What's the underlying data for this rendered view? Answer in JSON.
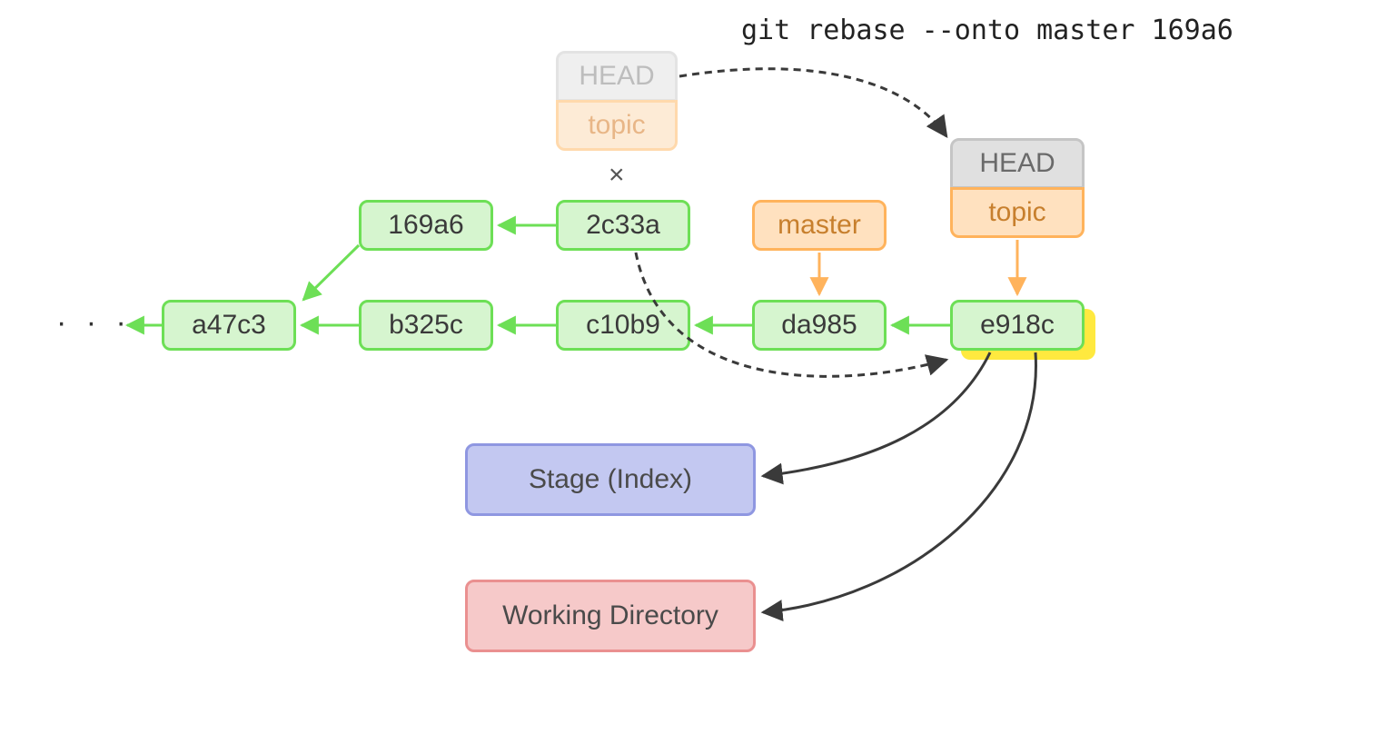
{
  "command": "git rebase --onto master 169a6",
  "ellipsis": "· · ·",
  "cross": "×",
  "commits": {
    "c169a6": "169a6",
    "c2c33a": "2c33a",
    "ca47c3": "a47c3",
    "cb325c": "b325c",
    "cc10b9": "c10b9",
    "cda985": "da985",
    "ce918c": "e918c"
  },
  "refs": {
    "head_old": "HEAD",
    "topic_old": "topic",
    "master": "master",
    "head_new": "HEAD",
    "topic_new": "topic"
  },
  "areas": {
    "stage": "Stage (Index)",
    "work": "Working Directory"
  }
}
